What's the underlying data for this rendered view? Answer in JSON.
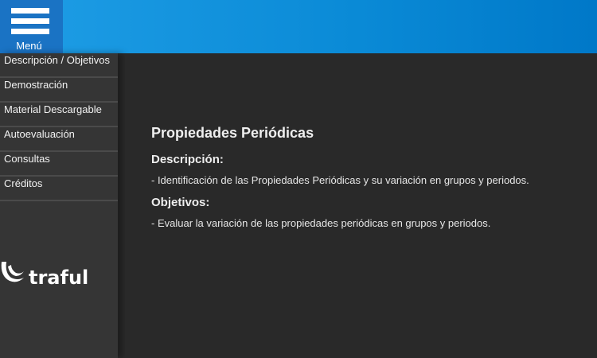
{
  "header": {
    "menu_label": "Menú",
    "colors": {
      "bar_start": "#1f9ee6",
      "bar_end": "#0078c8",
      "menu_button": "#1a73c4"
    }
  },
  "sidebar": {
    "items": [
      {
        "label": "Descripción / Objetivos"
      },
      {
        "label": "Demostración"
      },
      {
        "label": "Material Descargable"
      },
      {
        "label": "Autoevaluación"
      },
      {
        "label": "Consultas"
      },
      {
        "label": "Créditos"
      }
    ],
    "logo_text": "traful"
  },
  "main": {
    "title": "Propiedades Periódicas",
    "description_heading": "Descripción:",
    "description_text": "- Identificación de las Propiedades Periódicas y su variación en grupos y periodos.",
    "objectives_heading": "Objetivos:",
    "objectives_text": "- Evaluar la variación de las propiedades periódicas en grupos y periodos."
  },
  "icons": {
    "menu": "hamburger-icon",
    "logo": "traful-logo"
  }
}
